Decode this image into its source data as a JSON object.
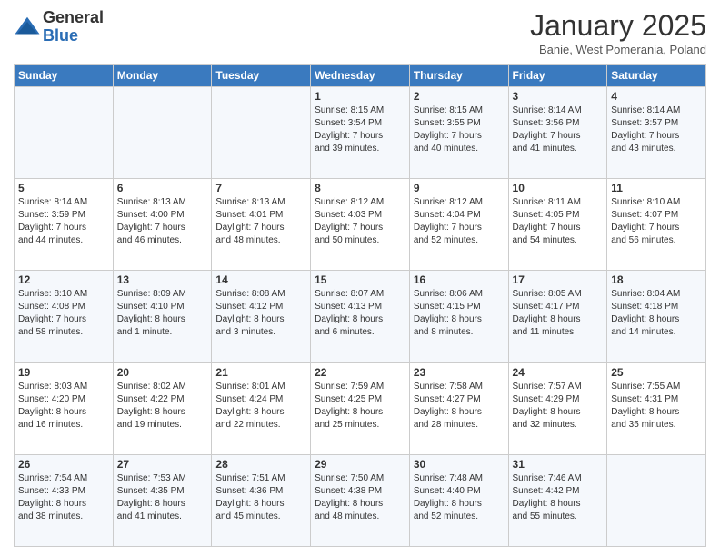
{
  "logo": {
    "general": "General",
    "blue": "Blue"
  },
  "title": "January 2025",
  "subtitle": "Banie, West Pomerania, Poland",
  "days_of_week": [
    "Sunday",
    "Monday",
    "Tuesday",
    "Wednesday",
    "Thursday",
    "Friday",
    "Saturday"
  ],
  "weeks": [
    [
      {
        "day": "",
        "info": ""
      },
      {
        "day": "",
        "info": ""
      },
      {
        "day": "",
        "info": ""
      },
      {
        "day": "1",
        "info": "Sunrise: 8:15 AM\nSunset: 3:54 PM\nDaylight: 7 hours\nand 39 minutes."
      },
      {
        "day": "2",
        "info": "Sunrise: 8:15 AM\nSunset: 3:55 PM\nDaylight: 7 hours\nand 40 minutes."
      },
      {
        "day": "3",
        "info": "Sunrise: 8:14 AM\nSunset: 3:56 PM\nDaylight: 7 hours\nand 41 minutes."
      },
      {
        "day": "4",
        "info": "Sunrise: 8:14 AM\nSunset: 3:57 PM\nDaylight: 7 hours\nand 43 minutes."
      }
    ],
    [
      {
        "day": "5",
        "info": "Sunrise: 8:14 AM\nSunset: 3:59 PM\nDaylight: 7 hours\nand 44 minutes."
      },
      {
        "day": "6",
        "info": "Sunrise: 8:13 AM\nSunset: 4:00 PM\nDaylight: 7 hours\nand 46 minutes."
      },
      {
        "day": "7",
        "info": "Sunrise: 8:13 AM\nSunset: 4:01 PM\nDaylight: 7 hours\nand 48 minutes."
      },
      {
        "day": "8",
        "info": "Sunrise: 8:12 AM\nSunset: 4:03 PM\nDaylight: 7 hours\nand 50 minutes."
      },
      {
        "day": "9",
        "info": "Sunrise: 8:12 AM\nSunset: 4:04 PM\nDaylight: 7 hours\nand 52 minutes."
      },
      {
        "day": "10",
        "info": "Sunrise: 8:11 AM\nSunset: 4:05 PM\nDaylight: 7 hours\nand 54 minutes."
      },
      {
        "day": "11",
        "info": "Sunrise: 8:10 AM\nSunset: 4:07 PM\nDaylight: 7 hours\nand 56 minutes."
      }
    ],
    [
      {
        "day": "12",
        "info": "Sunrise: 8:10 AM\nSunset: 4:08 PM\nDaylight: 7 hours\nand 58 minutes."
      },
      {
        "day": "13",
        "info": "Sunrise: 8:09 AM\nSunset: 4:10 PM\nDaylight: 8 hours\nand 1 minute."
      },
      {
        "day": "14",
        "info": "Sunrise: 8:08 AM\nSunset: 4:12 PM\nDaylight: 8 hours\nand 3 minutes."
      },
      {
        "day": "15",
        "info": "Sunrise: 8:07 AM\nSunset: 4:13 PM\nDaylight: 8 hours\nand 6 minutes."
      },
      {
        "day": "16",
        "info": "Sunrise: 8:06 AM\nSunset: 4:15 PM\nDaylight: 8 hours\nand 8 minutes."
      },
      {
        "day": "17",
        "info": "Sunrise: 8:05 AM\nSunset: 4:17 PM\nDaylight: 8 hours\nand 11 minutes."
      },
      {
        "day": "18",
        "info": "Sunrise: 8:04 AM\nSunset: 4:18 PM\nDaylight: 8 hours\nand 14 minutes."
      }
    ],
    [
      {
        "day": "19",
        "info": "Sunrise: 8:03 AM\nSunset: 4:20 PM\nDaylight: 8 hours\nand 16 minutes."
      },
      {
        "day": "20",
        "info": "Sunrise: 8:02 AM\nSunset: 4:22 PM\nDaylight: 8 hours\nand 19 minutes."
      },
      {
        "day": "21",
        "info": "Sunrise: 8:01 AM\nSunset: 4:24 PM\nDaylight: 8 hours\nand 22 minutes."
      },
      {
        "day": "22",
        "info": "Sunrise: 7:59 AM\nSunset: 4:25 PM\nDaylight: 8 hours\nand 25 minutes."
      },
      {
        "day": "23",
        "info": "Sunrise: 7:58 AM\nSunset: 4:27 PM\nDaylight: 8 hours\nand 28 minutes."
      },
      {
        "day": "24",
        "info": "Sunrise: 7:57 AM\nSunset: 4:29 PM\nDaylight: 8 hours\nand 32 minutes."
      },
      {
        "day": "25",
        "info": "Sunrise: 7:55 AM\nSunset: 4:31 PM\nDaylight: 8 hours\nand 35 minutes."
      }
    ],
    [
      {
        "day": "26",
        "info": "Sunrise: 7:54 AM\nSunset: 4:33 PM\nDaylight: 8 hours\nand 38 minutes."
      },
      {
        "day": "27",
        "info": "Sunrise: 7:53 AM\nSunset: 4:35 PM\nDaylight: 8 hours\nand 41 minutes."
      },
      {
        "day": "28",
        "info": "Sunrise: 7:51 AM\nSunset: 4:36 PM\nDaylight: 8 hours\nand 45 minutes."
      },
      {
        "day": "29",
        "info": "Sunrise: 7:50 AM\nSunset: 4:38 PM\nDaylight: 8 hours\nand 48 minutes."
      },
      {
        "day": "30",
        "info": "Sunrise: 7:48 AM\nSunset: 4:40 PM\nDaylight: 8 hours\nand 52 minutes."
      },
      {
        "day": "31",
        "info": "Sunrise: 7:46 AM\nSunset: 4:42 PM\nDaylight: 8 hours\nand 55 minutes."
      },
      {
        "day": "",
        "info": ""
      }
    ]
  ]
}
